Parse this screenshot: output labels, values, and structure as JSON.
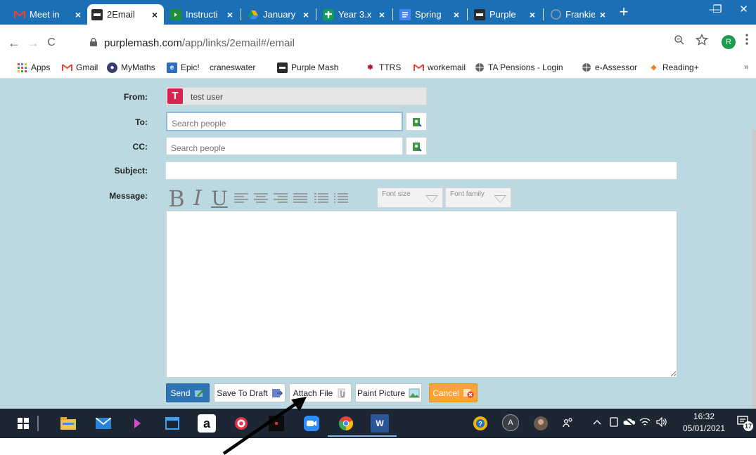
{
  "browser": {
    "tabs": [
      {
        "label": "Meet in",
        "icon": "gmail-icon",
        "color": "#ffffff",
        "active": false
      },
      {
        "label": "2Email",
        "icon": "purplemash-icon",
        "color": "#3a3a3a",
        "active": true
      },
      {
        "label": "Instructi",
        "icon": "classroom-icon",
        "color": "#1e8e3e",
        "active": false
      },
      {
        "label": "January",
        "icon": "drive-icon",
        "color": "#f4b400",
        "active": false
      },
      {
        "label": "Year 3.x",
        "icon": "plus-doc-icon",
        "color": "#0f9d58",
        "active": false
      },
      {
        "label": "Spring",
        "icon": "docs-icon",
        "color": "#4285f4",
        "active": false
      },
      {
        "label": "Purple",
        "icon": "purplemash-icon",
        "color": "#3a3a3a",
        "active": false
      },
      {
        "label": "Frankie",
        "icon": "globe-icon",
        "color": "#9aa0a6",
        "active": false
      }
    ],
    "tab_close_glyph": "×",
    "new_tab_glyph": "+",
    "window_buttons": {
      "minimize": "—",
      "maximize": "❐",
      "close": "✕"
    },
    "nav": {
      "back": "←",
      "forward": "→",
      "reload": "C"
    },
    "url": {
      "host": "purplemash.com",
      "path": "/app/links/2email#/email"
    },
    "profile_initial": "R",
    "bookmarks": [
      {
        "label": "Apps",
        "icon": "apps-grid-icon"
      },
      {
        "label": "Gmail",
        "icon": "gmail-icon"
      },
      {
        "label": "MyMaths",
        "icon": "mymaths-icon"
      },
      {
        "label": "Epic!",
        "icon": "epic-icon"
      },
      {
        "label": "craneswater",
        "icon": ""
      },
      {
        "label": "Purple Mash",
        "icon": "purplemash-icon"
      },
      {
        "label": "TTRS",
        "icon": "ttrs-icon"
      },
      {
        "label": "workemail",
        "icon": "gmail-icon"
      },
      {
        "label": "TA Pensions - Login",
        "icon": "globe-icon"
      },
      {
        "label": "e-Assessor",
        "icon": "globe-icon"
      },
      {
        "label": "Reading+",
        "icon": "readingplus-icon"
      }
    ],
    "bookmarks_overflow": "»"
  },
  "email_form": {
    "from_label": "From:",
    "from_avatar_letter": "T",
    "from_value": "test user",
    "to_label": "To:",
    "to_placeholder": "Search people",
    "cc_label": "CC:",
    "cc_placeholder": "Search people",
    "subject_label": "Subject:",
    "subject_value": "",
    "message_label": "Message:",
    "toolbar": {
      "bold": "B",
      "italic": "I",
      "underline": "U",
      "font_size_placeholder": "Font size",
      "font_family_placeholder": "Font family"
    },
    "buttons": {
      "send": "Send",
      "save_draft": "Save To Draft",
      "attach_file": "Attach File",
      "paint_picture": "Paint Picture",
      "cancel": "Cancel"
    }
  },
  "taskbar": {
    "time": "16:32",
    "date": "05/01/2021",
    "notification_count": "17",
    "amazon_letter": "a",
    "avatar_letter": "A",
    "word_letter": "W"
  },
  "colors": {
    "tabstrip": "#1c6fb4",
    "page_background": "#bcd9e2",
    "send_button": "#2e74b5",
    "cancel_button": "#f9a338",
    "avatar": "#d6264f",
    "taskbar": "#1c2733"
  }
}
